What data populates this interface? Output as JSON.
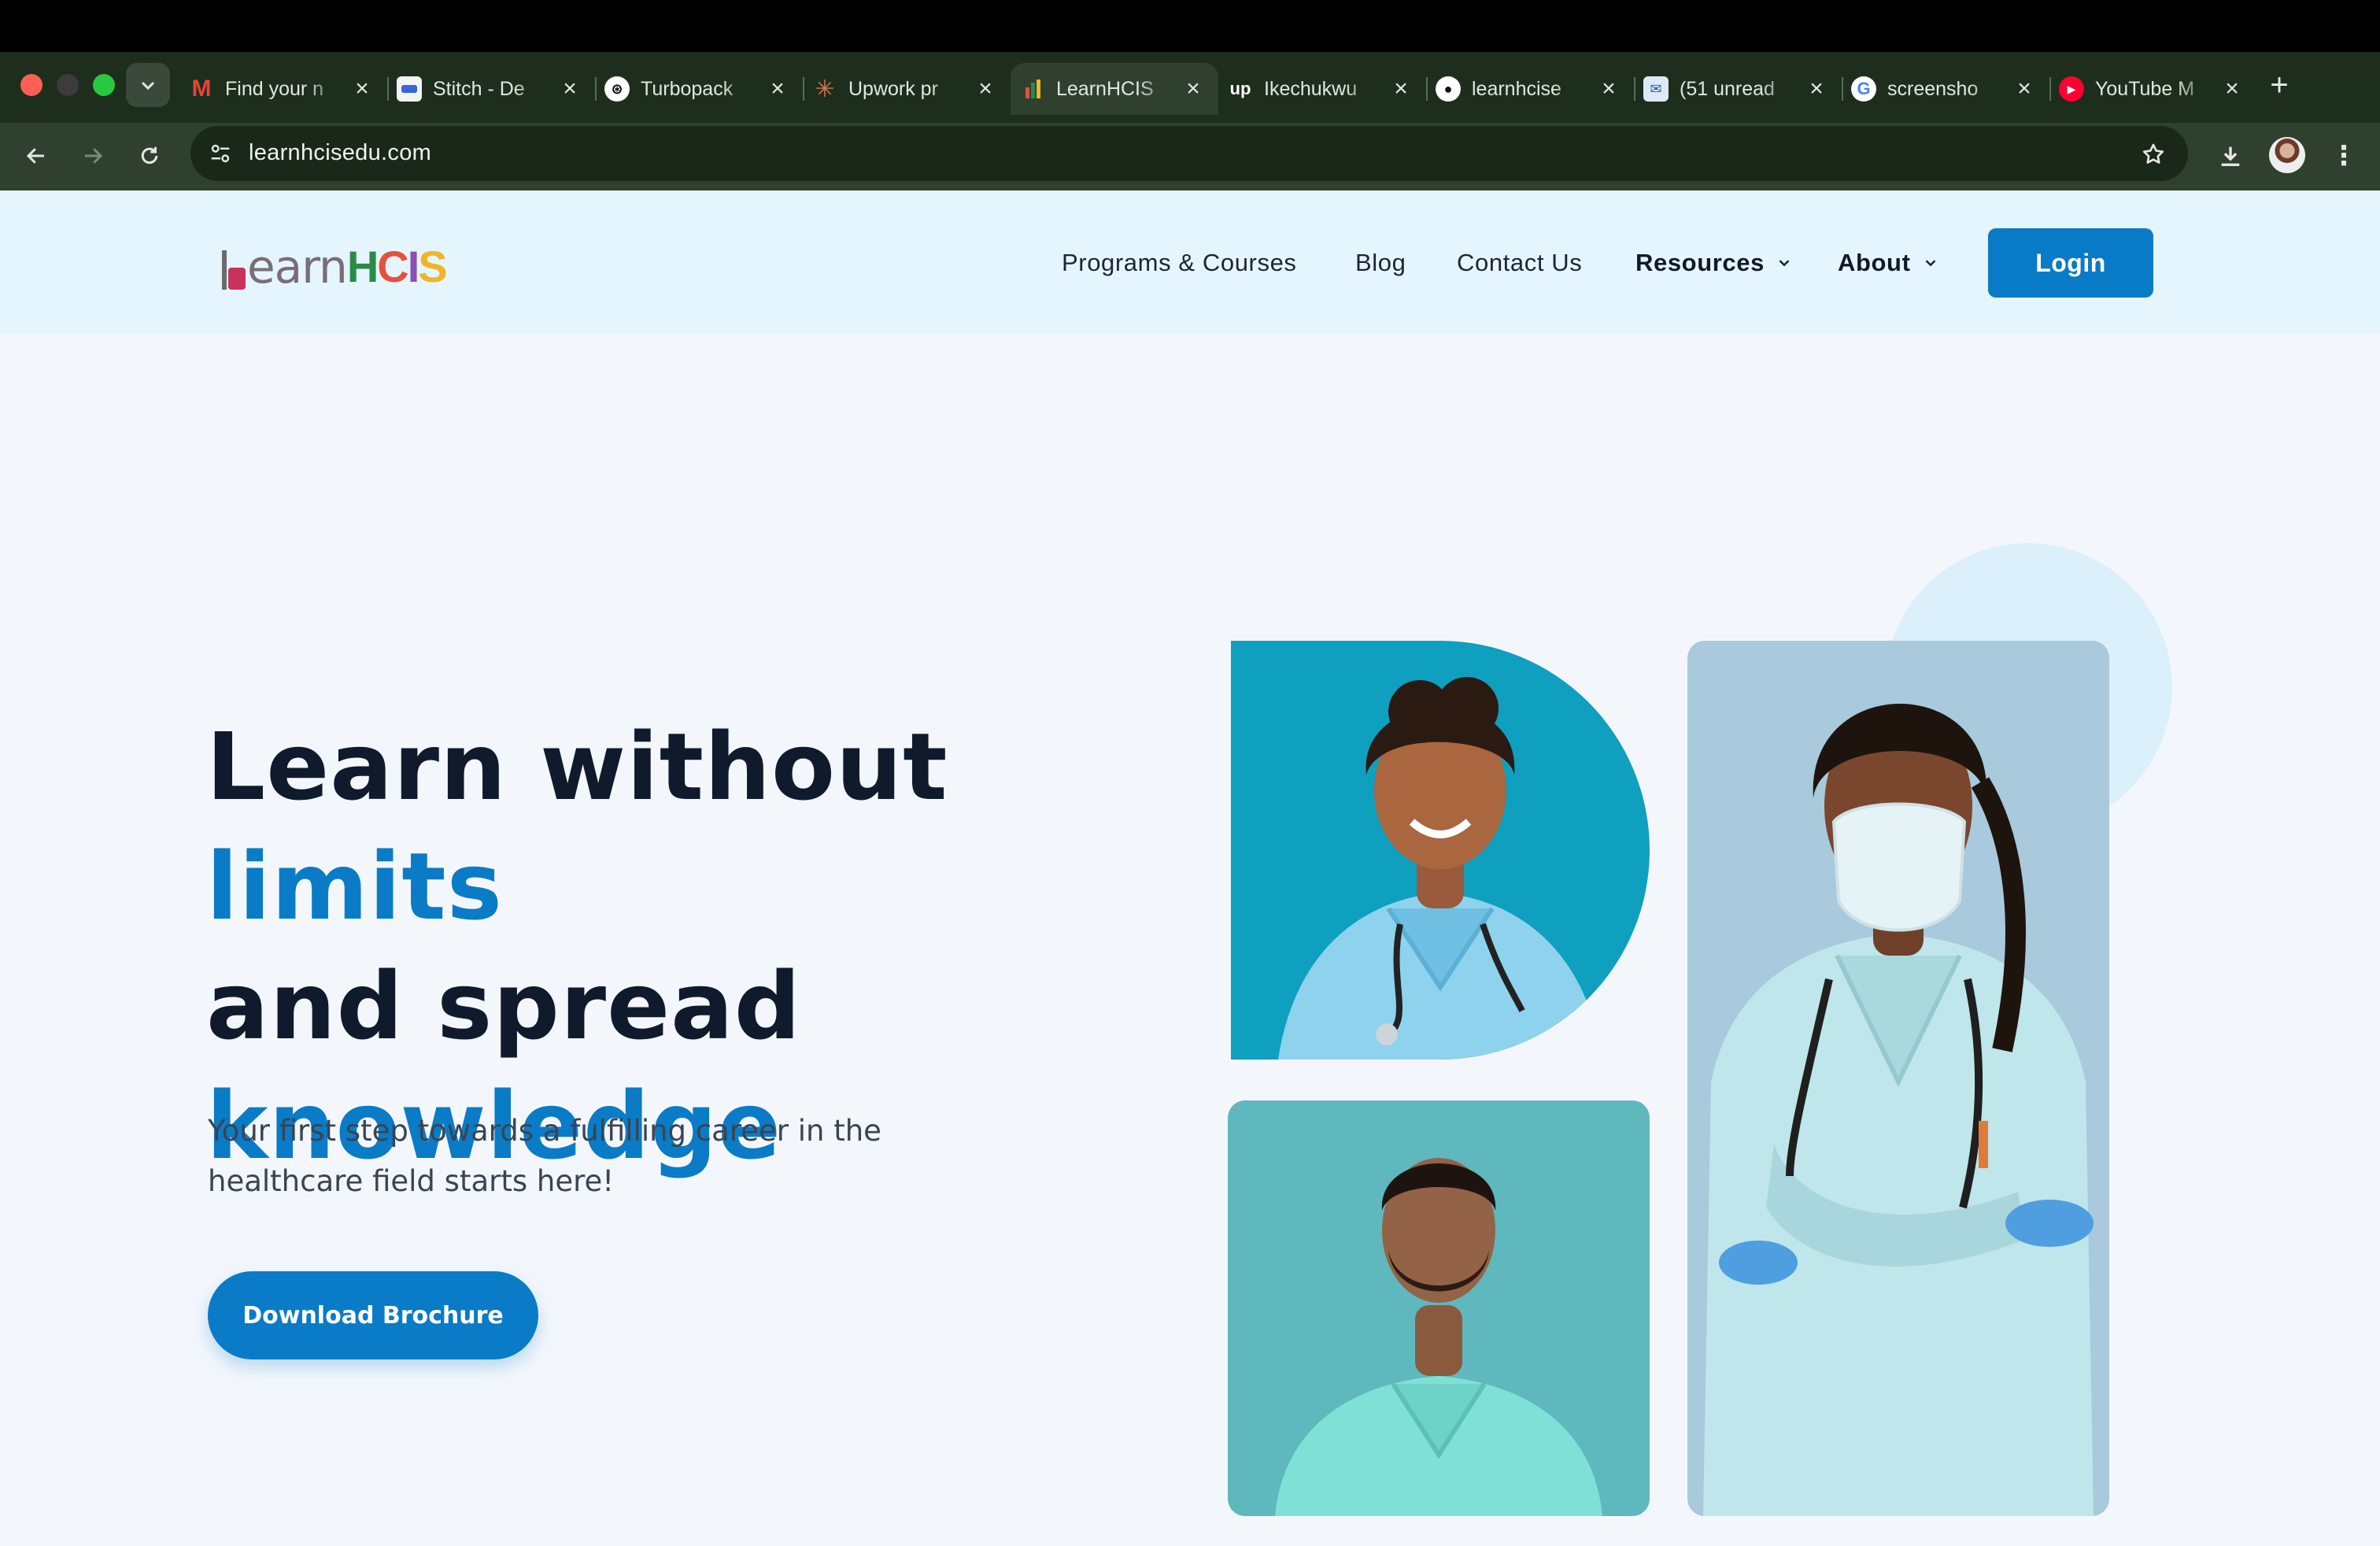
{
  "browser": {
    "tabs": [
      {
        "title": "Find your n",
        "favicon": "gmail-icon",
        "active": false
      },
      {
        "title": "Stitch - De",
        "favicon": "stitch-icon",
        "active": false
      },
      {
        "title": "Turbopack",
        "favicon": "openai-icon",
        "active": false
      },
      {
        "title": "Upwork pr",
        "favicon": "claude-icon",
        "active": false
      },
      {
        "title": "LearnHCIS",
        "favicon": "learnhcis-icon",
        "active": true
      },
      {
        "title": "Ikechukwu",
        "favicon": "upwork-icon",
        "active": false
      },
      {
        "title": "learnhcise",
        "favicon": "github-icon",
        "active": false
      },
      {
        "title": "(51 unread",
        "favicon": "mail-icon",
        "active": false
      },
      {
        "title": "screensho",
        "favicon": "google-icon",
        "active": false
      },
      {
        "title": "YouTube M",
        "favicon": "youtube-music-icon",
        "active": false
      }
    ],
    "url": "learnhcisedu.com",
    "colors": {
      "chrome_dark": "#1d2e1d",
      "toolbar": "#2f402f"
    }
  },
  "site": {
    "logo": {
      "learn": "earn",
      "hcis_letters": [
        "H",
        "C",
        "I",
        "S"
      ],
      "hcis_colors": [
        "#2a8a4a",
        "#e5513c",
        "#8a4fb0",
        "#f0b429"
      ]
    },
    "nav": {
      "programs": "Programs & Courses",
      "blog": "Blog",
      "contact": "Contact Us",
      "resources": "Resources",
      "about": "About",
      "login": "Login"
    },
    "hero": {
      "line1_a": "Learn without ",
      "line1_b": "limits",
      "line2": "and spread",
      "line3": "knowledge",
      "subtitle": "Your first step towards a fulfilling career in the healthcare field starts here!",
      "cta": "Download Brochure"
    },
    "colors": {
      "primary": "#0a7bc6",
      "heading": "#0f1b2d",
      "header_bg": "#e5f5fd",
      "page_bg": "#f3f7fc"
    }
  }
}
